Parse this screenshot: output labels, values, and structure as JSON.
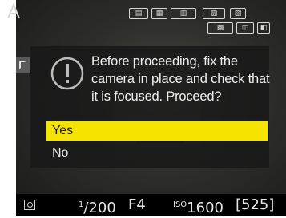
{
  "dialog": {
    "message": "Before proceeding, fix the camera in place and check that it is focused. Proceed?",
    "options": [
      {
        "label": "Yes",
        "selected": true
      },
      {
        "label": "No",
        "selected": false
      }
    ],
    "highlight_color": "#f5e400"
  },
  "status_bar": {
    "shutter_numerator": "1",
    "shutter_denominator": "/200",
    "aperture": "F4",
    "iso_label": "ISO",
    "iso_value": "1600",
    "shots_remaining": "[525]"
  },
  "icons": {
    "mode": "auto-mode-icon",
    "warning": "exclamation-warning-icon",
    "metering": "matrix-metering-icon"
  }
}
